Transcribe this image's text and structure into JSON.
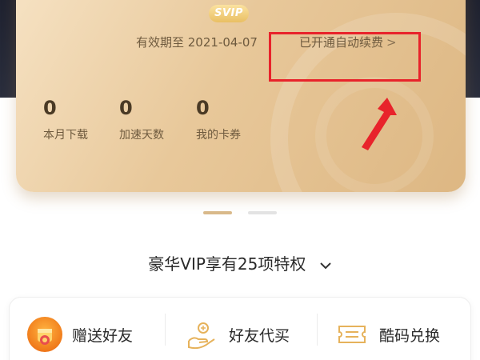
{
  "card": {
    "badge": "SVIP",
    "expiry": "有效期至 2021-04-07",
    "auto_renew": "已开通自动续费",
    "auto_renew_chevron": ">",
    "stats": [
      {
        "value": "0",
        "label": "本月下载"
      },
      {
        "value": "0",
        "label": "加速天数"
      },
      {
        "value": "0",
        "label": "我的卡券"
      }
    ]
  },
  "privileges": {
    "title": "豪华VIP享有25项特权"
  },
  "actions": [
    {
      "label": "赠送好友",
      "icon": "gift-icon"
    },
    {
      "label": "好友代买",
      "icon": "hand-coin-icon"
    },
    {
      "label": "酷码兑换",
      "icon": "ticket-icon"
    }
  ],
  "colors": {
    "card_gold": "#e8c89a",
    "highlight_red": "#e8232b",
    "arrow_red": "#e8232b",
    "pager_active": "#d9b98a"
  }
}
